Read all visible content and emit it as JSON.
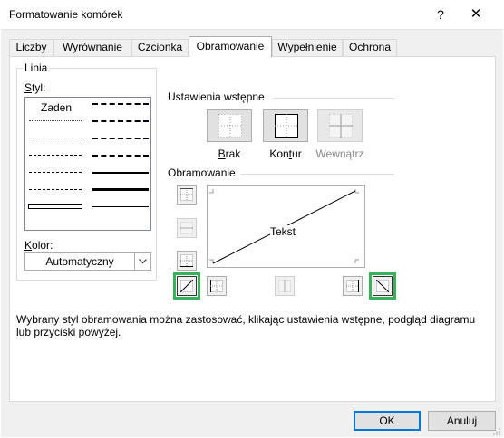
{
  "window": {
    "title": "Formatowanie komórek",
    "help_glyph": "?",
    "close_glyph": "✕"
  },
  "tabs": [
    {
      "label": "Liczby",
      "active": false
    },
    {
      "label": "Wyrównanie",
      "active": false
    },
    {
      "label": "Czcionka",
      "active": false
    },
    {
      "label": "Obramowanie",
      "active": true
    },
    {
      "label": "Wypełnienie",
      "active": false
    },
    {
      "label": "Ochrona",
      "active": false
    }
  ],
  "line_group": {
    "title": "Linia",
    "style_label_first": "S",
    "style_label_rest": "tyl:",
    "none_label": "Żaden",
    "color_label_first": "K",
    "color_label_rest": "olor:",
    "color_value": "Automatyczny"
  },
  "presets": {
    "title": "Ustawienia wstępne",
    "none": {
      "first": "B",
      "rest": "rak"
    },
    "outline": {
      "pre": "Kon",
      "mnemonic": "t",
      "post": "ur"
    },
    "inside": "Wewnątrz"
  },
  "border": {
    "title": "Obramowanie",
    "preview_text": "Tekst"
  },
  "description": "Wybrany styl obramowania można zastosować, klikając ustawienia wstępne, podgląd diagramu lub przyciski powyżej.",
  "footer": {
    "ok": "OK",
    "cancel": "Anuluj"
  },
  "colors": {
    "highlight": "#38b15a",
    "default_button_border": "#0078d7"
  }
}
